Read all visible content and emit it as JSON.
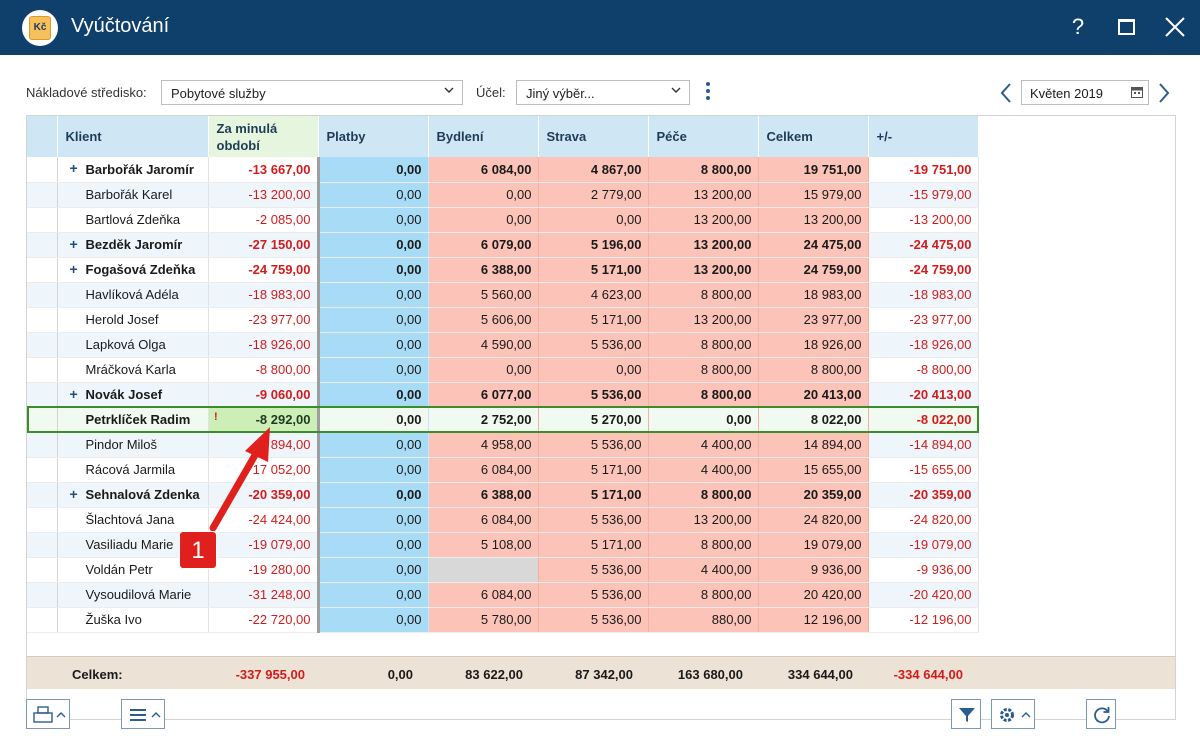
{
  "window": {
    "title": "Vyúčtování",
    "app_icon_text": "Kč",
    "help_label": "?"
  },
  "toolbar": {
    "center_label": "Nákladové středisko:",
    "center_value": "Pobytové služby",
    "purpose_label": "Účel:",
    "purpose_value": "Jiný výběr...",
    "period_value": "Květen 2019"
  },
  "table": {
    "columns": [
      "Klient",
      "Za minulá období",
      "Platby",
      "Bydlení",
      "Strava",
      "Péče",
      "Celkem",
      "+/-"
    ],
    "rows": [
      {
        "name": "Barbořák Jaromír",
        "group": true,
        "prev": "-13 667,00",
        "platby": "0,00",
        "bydleni": "6 084,00",
        "strava": "4 867,00",
        "pece": "8 800,00",
        "celkem": "19 751,00",
        "diff": "-19 751,00"
      },
      {
        "name": "Barbořák Karel",
        "group": false,
        "prev": "-13 200,00",
        "platby": "0,00",
        "bydleni": "0,00",
        "strava": "2 779,00",
        "pece": "13 200,00",
        "celkem": "15 979,00",
        "diff": "-15 979,00"
      },
      {
        "name": "Bartlová Zdeňka",
        "group": false,
        "prev": "-2 085,00",
        "platby": "0,00",
        "bydleni": "0,00",
        "strava": "0,00",
        "pece": "13 200,00",
        "celkem": "13 200,00",
        "diff": "-13 200,00"
      },
      {
        "name": "Bezděk Jaromír",
        "group": true,
        "prev": "-27 150,00",
        "platby": "0,00",
        "bydleni": "6 079,00",
        "strava": "5 196,00",
        "pece": "13 200,00",
        "celkem": "24 475,00",
        "diff": "-24 475,00"
      },
      {
        "name": "Fogašová Zdeňka",
        "group": true,
        "prev": "-24 759,00",
        "platby": "0,00",
        "bydleni": "6 388,00",
        "strava": "5 171,00",
        "pece": "13 200,00",
        "celkem": "24 759,00",
        "diff": "-24 759,00"
      },
      {
        "name": "Havlíková Adéla",
        "group": false,
        "prev": "-18 983,00",
        "platby": "0,00",
        "bydleni": "5 560,00",
        "strava": "4 623,00",
        "pece": "8 800,00",
        "celkem": "18 983,00",
        "diff": "-18 983,00"
      },
      {
        "name": "Herold Josef",
        "group": false,
        "prev": "-23 977,00",
        "platby": "0,00",
        "bydleni": "5 606,00",
        "strava": "5 171,00",
        "pece": "13 200,00",
        "celkem": "23 977,00",
        "diff": "-23 977,00"
      },
      {
        "name": "Lapková Olga",
        "group": false,
        "prev": "-18 926,00",
        "platby": "0,00",
        "bydleni": "4 590,00",
        "strava": "5 536,00",
        "pece": "8 800,00",
        "celkem": "18 926,00",
        "diff": "-18 926,00"
      },
      {
        "name": "Mráčková Karla",
        "group": false,
        "prev": "-8 800,00",
        "platby": "0,00",
        "bydleni": "0,00",
        "strava": "0,00",
        "pece": "8 800,00",
        "celkem": "8 800,00",
        "diff": "-8 800,00"
      },
      {
        "name": "Novák Josef",
        "group": true,
        "prev": "-9 060,00",
        "platby": "0,00",
        "bydleni": "6 077,00",
        "strava": "5 536,00",
        "pece": "8 800,00",
        "celkem": "20 413,00",
        "diff": "-20 413,00"
      },
      {
        "name": "Petrklíček Radim",
        "group": false,
        "bold": true,
        "prev": "-8 292,00",
        "platby": "0,00",
        "bydleni": "2 752,00",
        "strava": "5 270,00",
        "pece": "0,00",
        "celkem": "8 022,00",
        "diff": "-8 022,00"
      },
      {
        "name": "Pindor Miloš",
        "group": false,
        "prev": "4 894,00",
        "platby": "0,00",
        "bydleni": "4 958,00",
        "strava": "5 536,00",
        "pece": "4 400,00",
        "celkem": "14 894,00",
        "diff": "-14 894,00"
      },
      {
        "name": "Rácová Jarmila",
        "group": false,
        "prev": "17 052,00",
        "platby": "0,00",
        "bydleni": "6 084,00",
        "strava": "5 171,00",
        "pece": "4 400,00",
        "celkem": "15 655,00",
        "diff": "-15 655,00"
      },
      {
        "name": "Sehnalová Zdenka",
        "group": true,
        "prev": "-20 359,00",
        "platby": "0,00",
        "bydleni": "6 388,00",
        "strava": "5 171,00",
        "pece": "8 800,00",
        "celkem": "20 359,00",
        "diff": "-20 359,00"
      },
      {
        "name": "Šlachtová Jana",
        "group": false,
        "prev": "-24 424,00",
        "platby": "0,00",
        "bydleni": "6 084,00",
        "strava": "5 536,00",
        "pece": "13 200,00",
        "celkem": "24 820,00",
        "diff": "-24 820,00"
      },
      {
        "name": "Vasiliadu Marie",
        "group": false,
        "prev": "-19 079,00",
        "platby": "0,00",
        "bydleni": "5 108,00",
        "strava": "5 171,00",
        "pece": "8 800,00",
        "celkem": "19 079,00",
        "diff": "-19 079,00"
      },
      {
        "name": "Voldán Petr",
        "group": false,
        "prev": "-19 280,00",
        "platby": "0,00",
        "bydleni": "",
        "strava": "5 536,00",
        "pece": "4 400,00",
        "celkem": "9 936,00",
        "diff": "-9 936,00"
      },
      {
        "name": "Vysoudilová Marie",
        "group": false,
        "prev": "-31 248,00",
        "platby": "0,00",
        "bydleni": "6 084,00",
        "strava": "5 536,00",
        "pece": "8 800,00",
        "celkem": "20 420,00",
        "diff": "-20 420,00"
      },
      {
        "name": "Žuška Ivo",
        "group": false,
        "prev": "-22 720,00",
        "platby": "0,00",
        "bydleni": "5 780,00",
        "strava": "5 536,00",
        "pece": "880,00",
        "celkem": "12 196,00",
        "diff": "-12 196,00"
      }
    ],
    "totals": {
      "label": "Celkem:",
      "prev": "-337 955,00",
      "platby": "0,00",
      "bydleni": "83 622,00",
      "strava": "87 342,00",
      "pece": "163 680,00",
      "celkem": "334 644,00",
      "diff": "-334 644,00"
    },
    "selected_row": 10
  },
  "annotation": {
    "label": "1"
  },
  "colors": {
    "titlebar": "#0f3f6b",
    "header": "#cfe6f5",
    "payments": "#a8dcf6",
    "costs": "#fcc4b8",
    "negative": "#d21c1c",
    "selection": "#3c8c2a",
    "annotation": "#e0201d"
  },
  "icons": [
    "app-icon",
    "help-icon",
    "maximize-icon",
    "close-icon",
    "chevron-down-icon",
    "kebab-menu-icon",
    "prev-period-icon",
    "next-period-icon",
    "calendar-icon",
    "print-icon",
    "menu-icon",
    "filter-icon",
    "settings-icon",
    "refresh-icon"
  ]
}
